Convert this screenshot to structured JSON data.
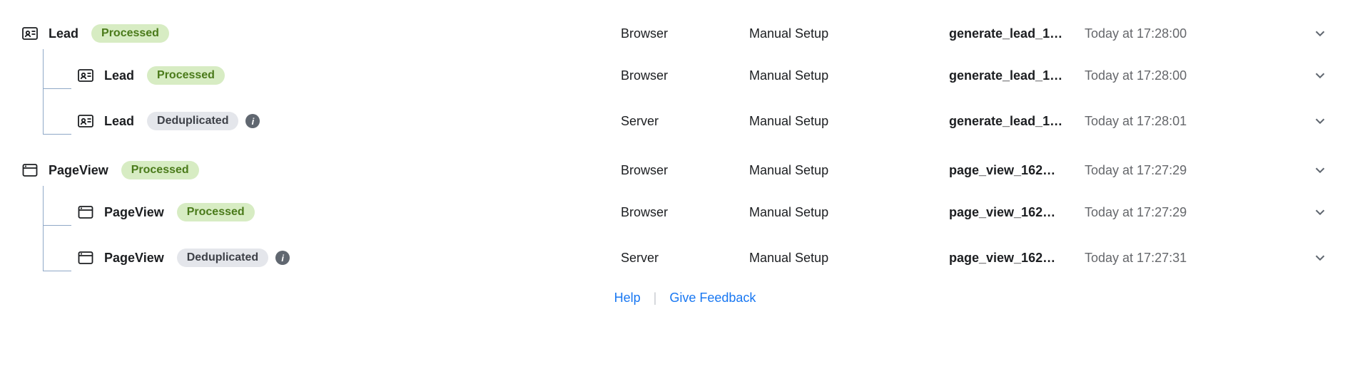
{
  "groups": [
    {
      "icon": "lead-icon",
      "name": "Lead",
      "status": "Processed",
      "statusKind": "processed",
      "source": "Browser",
      "method": "Manual Setup",
      "eventId": "generate_lead_1…",
      "time": "Today at 17:28:00",
      "children": [
        {
          "icon": "lead-icon",
          "name": "Lead",
          "status": "Processed",
          "statusKind": "processed",
          "source": "Browser",
          "method": "Manual Setup",
          "eventId": "generate_lead_1…",
          "time": "Today at 17:28:00"
        },
        {
          "icon": "lead-icon",
          "name": "Lead",
          "status": "Deduplicated",
          "statusKind": "dedup",
          "source": "Server",
          "method": "Manual Setup",
          "eventId": "generate_lead_1…",
          "time": "Today at 17:28:01"
        }
      ]
    },
    {
      "icon": "pageview-icon",
      "name": "PageView",
      "status": "Processed",
      "statusKind": "processed",
      "source": "Browser",
      "method": "Manual Setup",
      "eventId": "page_view_162…",
      "time": "Today at 17:27:29",
      "children": [
        {
          "icon": "pageview-icon",
          "name": "PageView",
          "status": "Processed",
          "statusKind": "processed",
          "source": "Browser",
          "method": "Manual Setup",
          "eventId": "page_view_162…",
          "time": "Today at 17:27:29"
        },
        {
          "icon": "pageview-icon",
          "name": "PageView",
          "status": "Deduplicated",
          "statusKind": "dedup",
          "source": "Server",
          "method": "Manual Setup",
          "eventId": "page_view_162…",
          "time": "Today at 17:27:31"
        }
      ]
    }
  ],
  "footer": {
    "help": "Help",
    "feedback": "Give Feedback"
  },
  "statusLabels": {
    "processed": "Processed",
    "dedup": "Deduplicated"
  }
}
